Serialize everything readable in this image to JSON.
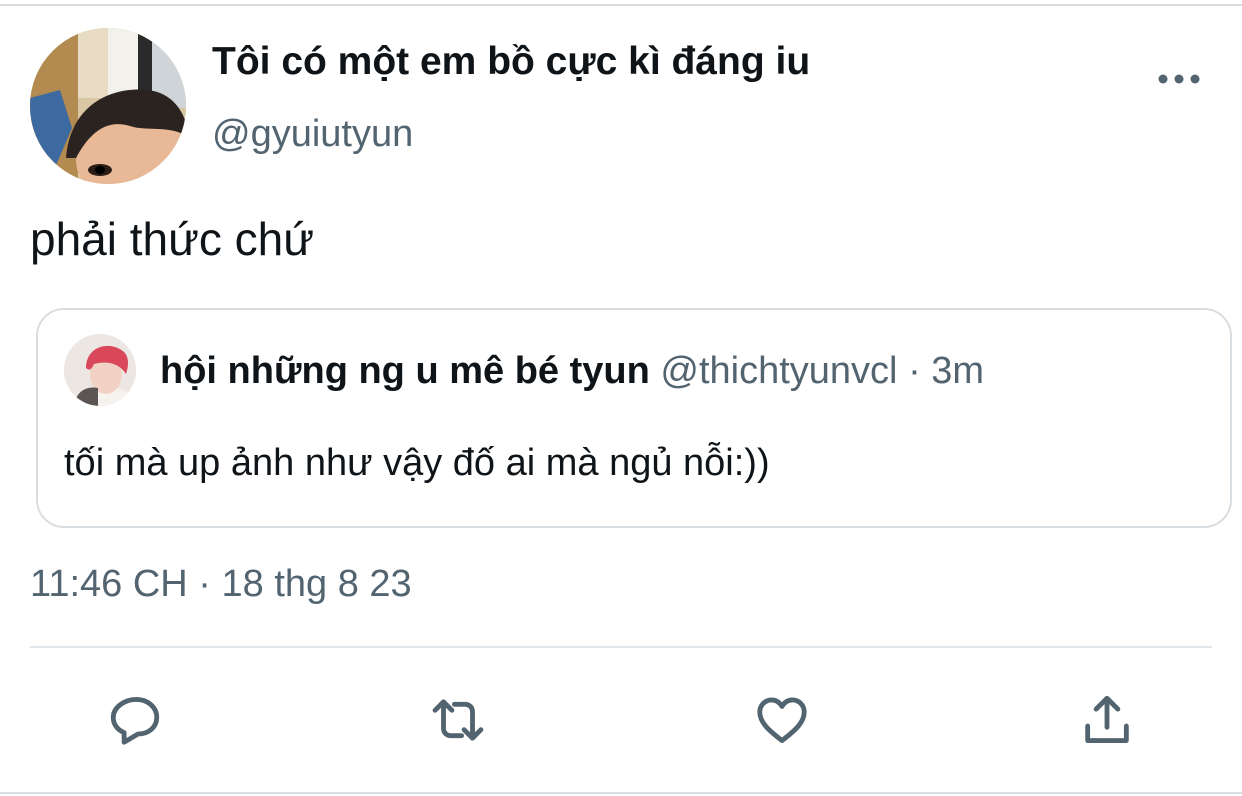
{
  "tweet": {
    "display_name": "Tôi có một em bồ cực kì đáng iu",
    "handle": "@gyuiutyun",
    "text": "phải thức chứ",
    "time": "11:46 CH",
    "separator": "·",
    "date": "18 thg 8 23"
  },
  "quoted_tweet": {
    "display_name": "hội những ng u mê bé tyun",
    "handle": "@thichtyunvcl",
    "separator": "·",
    "time": "3m",
    "text": "tối mà up ảnh như vậy đố ai mà ngủ nỗi:))"
  },
  "icons": {
    "more": "more-horizontal-icon",
    "reply": "reply-icon",
    "retweet": "retweet-icon",
    "like": "heart-icon",
    "share": "share-icon"
  },
  "colors": {
    "text_primary": "#0f1419",
    "text_secondary": "#536471",
    "border": "#d8dde1"
  }
}
